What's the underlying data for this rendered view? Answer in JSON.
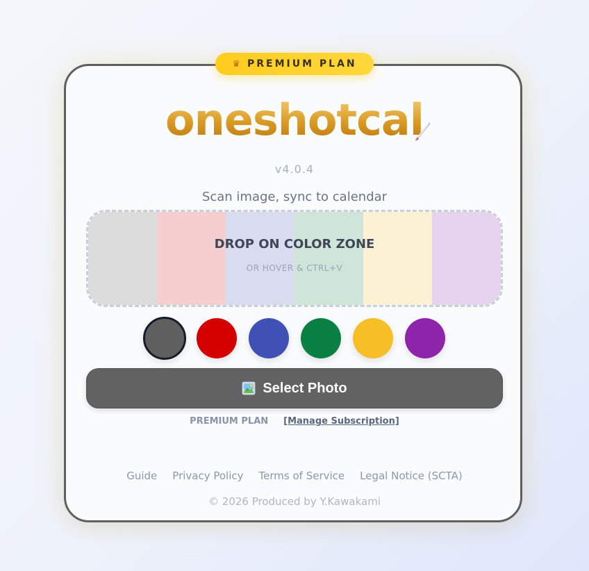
{
  "badge": {
    "icon": "crown-icon",
    "label": "PREMIUM PLAN",
    "color": "#ffcc1f"
  },
  "logo": {
    "text": "oneshotcal",
    "icon": "pen-icon"
  },
  "version": "v4.0.4",
  "tagline": "Scan image, sync to calendar",
  "dropzone": {
    "title": "DROP ON COLOR ZONE",
    "subtitle": "OR HOVER & CTRL+V",
    "stripes": [
      "#dcdcdc",
      "#f5cfd0",
      "#d9dcef",
      "#cfe5da",
      "#fbf1d4",
      "#e6d3ee"
    ]
  },
  "swatches": [
    {
      "name": "gray",
      "color": "#5f5f5f",
      "selected": true
    },
    {
      "name": "red",
      "color": "#d50000"
    },
    {
      "name": "blue",
      "color": "#3f51b5"
    },
    {
      "name": "green",
      "color": "#0b8043"
    },
    {
      "name": "yellow",
      "color": "#f6bf26"
    },
    {
      "name": "purple",
      "color": "#8e24aa"
    }
  ],
  "select_button": {
    "icon": "picture-icon",
    "label": "Select Photo",
    "color": "#626262"
  },
  "plan_row": {
    "plan_label": "PREMIUM PLAN",
    "manage_link": "[Manage Subscription]"
  },
  "footer": {
    "links": [
      "Guide",
      "Privacy Policy",
      "Terms of Service",
      "Legal Notice (SCTA)"
    ],
    "copyright": "© 2026 Produced by Y.Kawakami"
  }
}
